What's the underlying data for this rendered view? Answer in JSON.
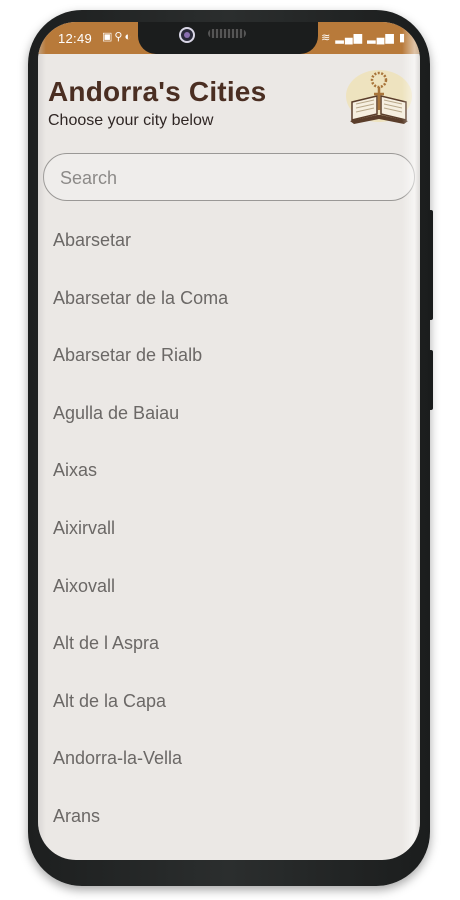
{
  "status_bar": {
    "time": "12:49",
    "left_icons": [
      "gallery-icon",
      "usb-icon",
      "sync-icon"
    ],
    "right_icons": [
      "mute-icon",
      "wifi-icon",
      "signal-icon",
      "signal-icon",
      "battery-icon"
    ],
    "color": "#b87a3a"
  },
  "header": {
    "title": "Andorra's Cities",
    "subtitle": "Choose your city below",
    "logo_icon": "book-with-rosary-icon"
  },
  "search": {
    "placeholder": "Search",
    "value": ""
  },
  "cities": [
    "Abarsetar",
    "Abarsetar de la Coma",
    "Abarsetar de Rialb",
    "Agulla de Baiau",
    "Aixas",
    "Aixirvall",
    "Aixovall",
    "Alt de l Aspra",
    "Alt de la Capa",
    "Andorra-la-Vella",
    "Arans"
  ],
  "colors": {
    "background": "#ebe8e5",
    "title": "#4a2e22",
    "list_text": "#6b6866"
  }
}
